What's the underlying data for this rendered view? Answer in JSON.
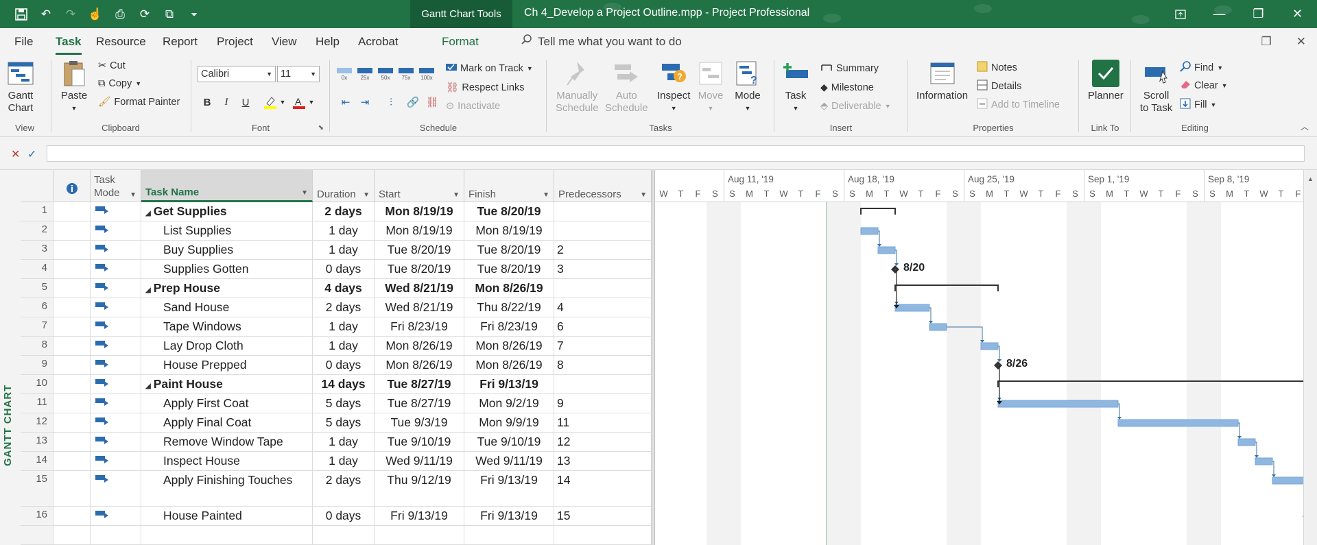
{
  "titlebar": {
    "context_tab": "Gantt Chart Tools",
    "doc_title": "Ch 4_Develop a Project Outline.mpp  -  Project Professional"
  },
  "tabs": {
    "file": "File",
    "task": "Task",
    "resource": "Resource",
    "report": "Report",
    "project": "Project",
    "view": "View",
    "help": "Help",
    "acrobat": "Acrobat",
    "format": "Format",
    "tellme": "Tell me what you want to do"
  },
  "ribbon": {
    "view": {
      "gantt_line1": "Gantt",
      "gantt_line2": "Chart",
      "label": "View"
    },
    "clipboard": {
      "paste": "Paste",
      "cut": "Cut",
      "copy": "Copy",
      "format_painter": "Format Painter",
      "label": "Clipboard"
    },
    "font": {
      "name": "Calibri",
      "size": "11",
      "bold": "B",
      "italic": "I",
      "underline": "U",
      "label": "Font"
    },
    "schedule": {
      "pct": [
        "0x",
        "25x",
        "50x",
        "75x",
        "100x"
      ],
      "mark_on_track": "Mark on Track",
      "respect_links": "Respect Links",
      "inactivate": "Inactivate",
      "label": "Schedule"
    },
    "tasks": {
      "manually1": "Manually",
      "manually2": "Schedule",
      "auto1": "Auto",
      "auto2": "Schedule",
      "inspect": "Inspect",
      "move": "Move",
      "mode": "Mode",
      "label": "Tasks"
    },
    "insert": {
      "task": "Task",
      "summary": "Summary",
      "milestone": "Milestone",
      "deliverable": "Deliverable",
      "label": "Insert"
    },
    "properties": {
      "information": "Information",
      "notes": "Notes",
      "details": "Details",
      "add_to_timeline": "Add to Timeline",
      "label": "Properties"
    },
    "linkto": {
      "planner": "Planner",
      "label": "Link To"
    },
    "editing": {
      "scroll1": "Scroll",
      "scroll2": "to Task",
      "find": "Find",
      "clear": "Clear",
      "fill": "Fill",
      "label": "Editing"
    }
  },
  "side_label": "GANTT CHART",
  "grid": {
    "headers": {
      "task_mode_1": "Task",
      "task_mode_2": "Mode",
      "task_name": "Task Name",
      "duration": "Duration",
      "start": "Start",
      "finish": "Finish",
      "predecessors": "Predecessors"
    },
    "rows": [
      {
        "id": "1",
        "name": "Get Supplies",
        "duration": "2 days",
        "start": "Mon 8/19/19",
        "finish": "Tue 8/20/19",
        "pred": "",
        "summary": true
      },
      {
        "id": "2",
        "name": "List Supplies",
        "duration": "1 day",
        "start": "Mon 8/19/19",
        "finish": "Mon 8/19/19",
        "pred": "",
        "summary": false
      },
      {
        "id": "3",
        "name": "Buy Supplies",
        "duration": "1 day",
        "start": "Tue 8/20/19",
        "finish": "Tue 8/20/19",
        "pred": "2",
        "summary": false
      },
      {
        "id": "4",
        "name": "Supplies Gotten",
        "duration": "0 days",
        "start": "Tue 8/20/19",
        "finish": "Tue 8/20/19",
        "pred": "3",
        "summary": false
      },
      {
        "id": "5",
        "name": "Prep House",
        "duration": "4 days",
        "start": "Wed 8/21/19",
        "finish": "Mon 8/26/19",
        "pred": "",
        "summary": true
      },
      {
        "id": "6",
        "name": "Sand House",
        "duration": "2 days",
        "start": "Wed 8/21/19",
        "finish": "Thu 8/22/19",
        "pred": "4",
        "summary": false
      },
      {
        "id": "7",
        "name": "Tape Windows",
        "duration": "1 day",
        "start": "Fri 8/23/19",
        "finish": "Fri 8/23/19",
        "pred": "6",
        "summary": false
      },
      {
        "id": "8",
        "name": "Lay Drop Cloth",
        "duration": "1 day",
        "start": "Mon 8/26/19",
        "finish": "Mon 8/26/19",
        "pred": "7",
        "summary": false
      },
      {
        "id": "9",
        "name": "House Prepped",
        "duration": "0 days",
        "start": "Mon 8/26/19",
        "finish": "Mon 8/26/19",
        "pred": "8",
        "summary": false
      },
      {
        "id": "10",
        "name": "Paint House",
        "duration": "14 days",
        "start": "Tue 8/27/19",
        "finish": "Fri 9/13/19",
        "pred": "",
        "summary": true
      },
      {
        "id": "11",
        "name": "Apply First Coat",
        "duration": "5 days",
        "start": "Tue 8/27/19",
        "finish": "Mon 9/2/19",
        "pred": "9",
        "summary": false
      },
      {
        "id": "12",
        "name": "Apply Final Coat",
        "duration": "5 days",
        "start": "Tue 9/3/19",
        "finish": "Mon 9/9/19",
        "pred": "11",
        "summary": false
      },
      {
        "id": "13",
        "name": "Remove Window Tape",
        "duration": "1 day",
        "start": "Tue 9/10/19",
        "finish": "Tue 9/10/19",
        "pred": "12",
        "summary": false
      },
      {
        "id": "14",
        "name": "Inspect House",
        "duration": "1 day",
        "start": "Wed 9/11/19",
        "finish": "Wed 9/11/19",
        "pred": "13",
        "summary": false
      },
      {
        "id": "15",
        "name": "Apply Finishing Touches",
        "duration": "2 days",
        "start": "Thu 9/12/19",
        "finish": "Fri 9/13/19",
        "pred": "14",
        "summary": false
      },
      {
        "id": "16",
        "name": "House Painted",
        "duration": "0 days",
        "start": "Fri 9/13/19",
        "finish": "Fri 9/13/19",
        "pred": "15",
        "summary": false
      }
    ]
  },
  "gantt": {
    "weeks": [
      "Aug 11, '19",
      "Aug 18, '19",
      "Aug 25, '19",
      "Sep 1, '19",
      "Sep 8, '19"
    ],
    "day_letters": [
      "W",
      "T",
      "F",
      "S",
      "S",
      "M",
      "T",
      "W",
      "T",
      "F",
      "S",
      "S",
      "M",
      "T",
      "W",
      "T",
      "F",
      "S",
      "S",
      "M",
      "T",
      "W",
      "T",
      "F",
      "S",
      "S",
      "M",
      "T",
      "W",
      "T",
      "F",
      "S",
      "S",
      "M",
      "T",
      "W",
      "T",
      "F"
    ],
    "milestone_labels": [
      "8/20",
      "8/26"
    ]
  },
  "colors": {
    "accent": "#217346",
    "bar": "#8fb7e0"
  }
}
